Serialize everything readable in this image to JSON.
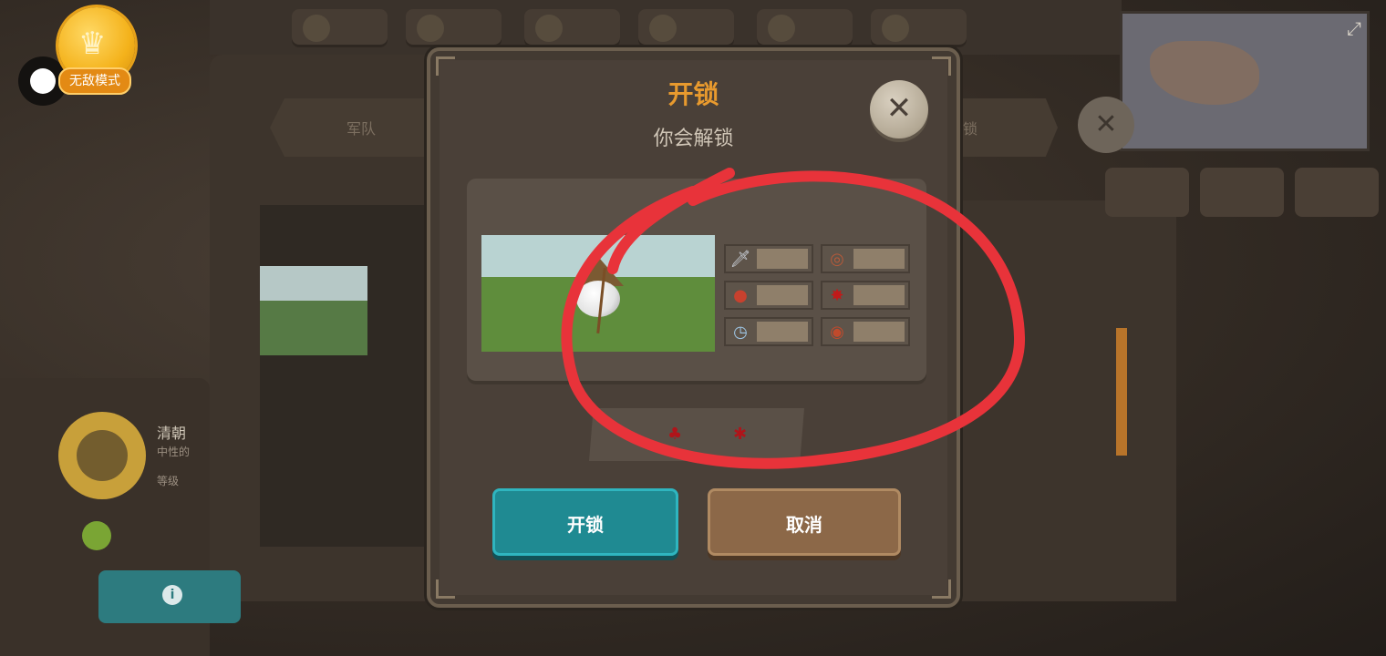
{
  "background": {
    "left_tab_label": "军队",
    "right_tab_label": "锁",
    "nation": {
      "name": "清朝",
      "attitude": "中性的",
      "level_label": "等级"
    },
    "minimap_expand_icon": "expand-icon"
  },
  "badge": {
    "mode_label": "无敌模式",
    "crown_icon": "crown-icon"
  },
  "modal": {
    "title": "开锁",
    "subtitle": "你会解锁",
    "close_icon": "close-icon",
    "unit": {
      "image_desc": "archer-ball-unit",
      "stats": [
        {
          "icon": "sword-icon",
          "value": ""
        },
        {
          "icon": "shield-icon",
          "value": ""
        },
        {
          "icon": "potion-icon",
          "value": ""
        },
        {
          "icon": "blood-splat-icon",
          "value": ""
        },
        {
          "icon": "stopwatch-icon",
          "value": ""
        },
        {
          "icon": "target-icon",
          "value": ""
        }
      ]
    },
    "cost": [
      {
        "icon": "meat-icon",
        "value": ""
      },
      {
        "icon": "gem-cluster-icon",
        "value": ""
      }
    ],
    "buttons": {
      "unlock": "开锁",
      "cancel": "取消"
    }
  },
  "colors": {
    "title_accent": "#e89a2e",
    "unlock_button": "#1f8a92",
    "cancel_button": "#8c6848",
    "annotation": "#e8333a"
  }
}
